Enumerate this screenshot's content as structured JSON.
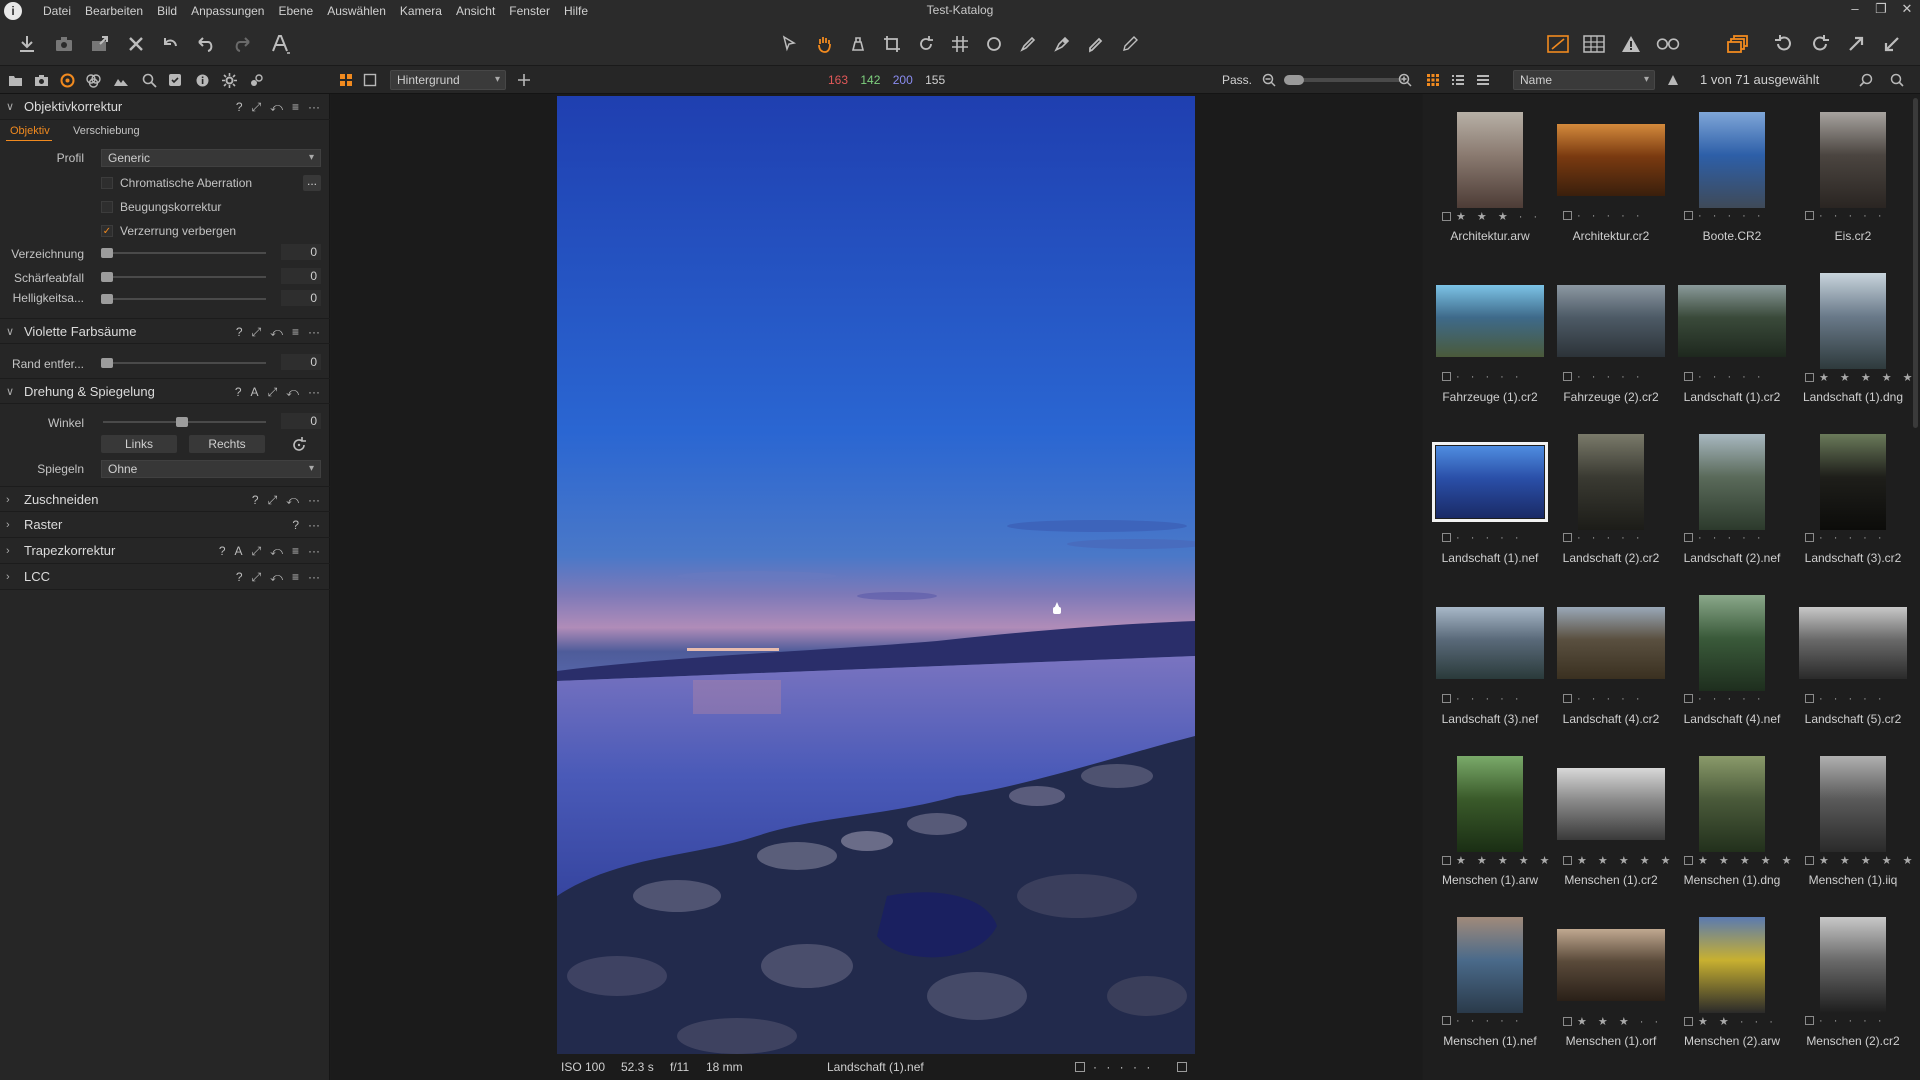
{
  "app": {
    "window_title": "Test-Katalog",
    "logo_glyph": "i",
    "menu": [
      "Datei",
      "Bearbeiten",
      "Bild",
      "Anpassungen",
      "Ebene",
      "Auswählen",
      "Kamera",
      "Ansicht",
      "Fenster",
      "Hilfe"
    ],
    "window_controls": [
      "–",
      "❐",
      "✕"
    ]
  },
  "strip": {
    "layer": "Hintergrund",
    "readout": {
      "r": "163",
      "g": "142",
      "b": "200",
      "l": "155"
    },
    "fit_label": "Pass.",
    "sort": "Name",
    "selection_count": "1 von 71 ausgewählt"
  },
  "colors": {
    "accent": "#f18a1f",
    "readout_r": "#e05858",
    "readout_g": "#7ed07e",
    "readout_b": "#8a8cf0"
  },
  "left": {
    "lens": {
      "title": "Objektivkorrektur",
      "tools": [
        "?",
        "⤢",
        "⤺",
        "≡",
        "···"
      ],
      "tabs": [
        "Objektiv",
        "Verschiebung"
      ],
      "profile_label": "Profil",
      "profile_value": "Generic",
      "checks": [
        {
          "label": "Chromatische Aberration",
          "checked": false
        },
        {
          "label": "Beugungskorrektur",
          "checked": false
        },
        {
          "label": "Verzerrung verbergen",
          "checked": true
        }
      ],
      "more_button": "...",
      "sliders": [
        {
          "label": "Verzeichnung",
          "value": "0"
        },
        {
          "label": "Schärfeabfall",
          "value": "0"
        },
        {
          "label": "Helligkeitsa...",
          "value": "0"
        }
      ]
    },
    "fringe": {
      "title": "Violette Farbsäume",
      "tools": [
        "?",
        "⤢",
        "⤺",
        "≡",
        "···"
      ],
      "slider_label": "Rand entfer...",
      "slider_value": "0"
    },
    "rotation": {
      "title": "Drehung & Spiegelung",
      "tools": [
        "?",
        "A",
        "⤢",
        "⤺",
        "···"
      ],
      "angle_label": "Winkel",
      "angle_value": "0",
      "btn_left": "Links",
      "btn_right": "Rechts",
      "mirror_label": "Spiegeln",
      "mirror_value": "Ohne"
    },
    "collapsed": [
      {
        "title": "Zuschneiden",
        "tools": [
          "?",
          "⤢",
          "⤺",
          "···"
        ]
      },
      {
        "title": "Raster",
        "tools": [
          "?",
          "···"
        ]
      },
      {
        "title": "Trapezkorrektur",
        "tools": [
          "?",
          "A",
          "⤢",
          "⤺",
          "≡",
          "···"
        ]
      },
      {
        "title": "LCC",
        "tools": [
          "?",
          "⤢",
          "⤺",
          "≡",
          "···"
        ]
      }
    ]
  },
  "viewer": {
    "iso": "ISO 100",
    "shutter": "52.3 s",
    "aperture": "f/11",
    "focal": "18 mm",
    "filename": "Landschaft (1).nef",
    "rating": "· · · · ·"
  },
  "browser": {
    "thumbs": [
      {
        "name": "Architektur.arw",
        "rating": "★ ★ ★ · ·",
        "orient": "portrait",
        "colors": [
          "#8a7a70",
          "#b7b0a6",
          "#4d3c36"
        ]
      },
      {
        "name": "Architektur.cr2",
        "rating": "· · · · ·",
        "orient": "landscape",
        "colors": [
          "#7a3a10",
          "#d48a3c",
          "#3a1f0c"
        ]
      },
      {
        "name": "Boote.CR2",
        "rating": "· · · · ·",
        "orient": "portrait",
        "colors": [
          "#2d5fa8",
          "#7fa6d8",
          "#3f4a58"
        ]
      },
      {
        "name": "Eis.cr2",
        "rating": "· · · · ·",
        "orient": "portrait",
        "colors": [
          "#4b4540",
          "#a7a39f",
          "#2a2522"
        ]
      },
      {
        "name": "Fahrzeuge (1).cr2",
        "rating": "· · · · ·",
        "orient": "landscape",
        "colors": [
          "#3e6a8a",
          "#7cc3e6",
          "#4a5a3a"
        ]
      },
      {
        "name": "Fahrzeuge (2).cr2",
        "rating": "· · · · ·",
        "orient": "landscape",
        "colors": [
          "#4d5a66",
          "#8c98a2",
          "#2c3338"
        ]
      },
      {
        "name": "Landschaft (1).cr2",
        "rating": "· · · · ·",
        "orient": "landscape",
        "colors": [
          "#3a4a3a",
          "#8a9a9a",
          "#1e281e"
        ]
      },
      {
        "name": "Landschaft (1).dng",
        "rating": "★ ★ ★ ★ ★",
        "orient": "portrait",
        "colors": [
          "#6a7a8a",
          "#c8d4dc",
          "#2e3a3c"
        ]
      },
      {
        "name": "Landschaft (1).nef",
        "rating": "· · · · ·",
        "orient": "landscape",
        "colors": [
          "#2a4fa8",
          "#4f8de0",
          "#1a2a66"
        ],
        "selected": true
      },
      {
        "name": "Landschaft (2).cr2",
        "rating": "· · · · ·",
        "orient": "portrait",
        "colors": [
          "#3a3a32",
          "#7a7a6a",
          "#1c1c18"
        ]
      },
      {
        "name": "Landschaft (2).nef",
        "rating": "· · · · ·",
        "orient": "portrait",
        "colors": [
          "#5a6a5a",
          "#a8b8c0",
          "#2c3a2c"
        ]
      },
      {
        "name": "Landschaft (3).cr2",
        "rating": "· · · · ·",
        "orient": "portrait",
        "colors": [
          "#1e1e1a",
          "#6a7a5a",
          "#0c0c0a"
        ]
      },
      {
        "name": "Landschaft (3).nef",
        "rating": "· · · · ·",
        "orient": "landscape",
        "colors": [
          "#5a6a7a",
          "#a8b8c8",
          "#2a3a3a"
        ]
      },
      {
        "name": "Landschaft (4).cr2",
        "rating": "· · · · ·",
        "orient": "landscape",
        "colors": [
          "#5a5040",
          "#9aa8b8",
          "#3a3020"
        ]
      },
      {
        "name": "Landschaft (4).nef",
        "rating": "· · · · ·",
        "orient": "portrait",
        "colors": [
          "#3a5a3a",
          "#8aa88a",
          "#1e2e1e"
        ]
      },
      {
        "name": "Landschaft (5).cr2",
        "rating": "· · · · ·",
        "orient": "landscape",
        "colors": [
          "#6a6a6a",
          "#c8c8c8",
          "#2a2a2a"
        ]
      },
      {
        "name": "Menschen (1).arw",
        "rating": "★ ★ ★ ★ ★",
        "orient": "portrait",
        "colors": [
          "#3a5a2a",
          "#7aaa6a",
          "#1a2e14"
        ]
      },
      {
        "name": "Menschen (1).cr2",
        "rating": "★ ★ ★ ★ ★",
        "orient": "landscape",
        "colors": [
          "#8a8a8a",
          "#d8d8d8",
          "#3a3a3a"
        ]
      },
      {
        "name": "Menschen (1).dng",
        "rating": "★ ★ ★ ★ ★",
        "orient": "portrait",
        "colors": [
          "#4a5a3a",
          "#8a9a6a",
          "#22301c"
        ]
      },
      {
        "name": "Menschen (1).iiq",
        "rating": "★ ★ ★ ★ ★",
        "orient": "portrait",
        "colors": [
          "#5a5a5a",
          "#b0b0b0",
          "#2a2a2a"
        ]
      },
      {
        "name": "Menschen (1).nef",
        "rating": "· · · · ·",
        "orient": "portrait",
        "colors": [
          "#4a6a8a",
          "#a08a7a",
          "#2a3a4a"
        ]
      },
      {
        "name": "Menschen (1).orf",
        "rating": "★ ★ ★ · ·",
        "orient": "landscape",
        "colors": [
          "#5a4a3a",
          "#c0a890",
          "#2a2018"
        ]
      },
      {
        "name": "Menschen (2).arw",
        "rating": "★ ★ · · ·",
        "orient": "portrait",
        "colors": [
          "#c8b030",
          "#5a7ab0",
          "#2a2a2a"
        ]
      },
      {
        "name": "Menschen (2).cr2",
        "rating": "· · · · ·",
        "orient": "portrait",
        "colors": [
          "#6a6a6a",
          "#c8c8c8",
          "#1e1e1e"
        ]
      }
    ]
  }
}
